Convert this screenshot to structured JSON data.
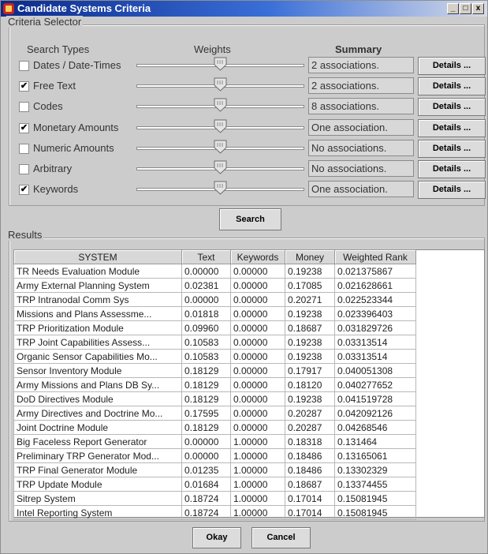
{
  "window": {
    "title": "Candidate Systems Criteria"
  },
  "criteria_selector": {
    "group_title": "Criteria Selector",
    "headers": {
      "search_types": "Search Types",
      "weights": "Weights",
      "summary": "Summary"
    },
    "rows": [
      {
        "label": "Dates / Date-Times",
        "checked": false,
        "weight_percent": 50,
        "summary": "2 associations.",
        "details_label": "Details ..."
      },
      {
        "label": "Free Text",
        "checked": true,
        "weight_percent": 50,
        "summary": "2 associations.",
        "details_label": "Details ..."
      },
      {
        "label": "Codes",
        "checked": false,
        "weight_percent": 50,
        "summary": "8 associations.",
        "details_label": "Details ..."
      },
      {
        "label": "Monetary Amounts",
        "checked": true,
        "weight_percent": 50,
        "summary": "One association.",
        "details_label": "Details ..."
      },
      {
        "label": "Numeric Amounts",
        "checked": false,
        "weight_percent": 50,
        "summary": "No associations.",
        "details_label": "Details ..."
      },
      {
        "label": "Arbitrary",
        "checked": false,
        "weight_percent": 50,
        "summary": "No associations.",
        "details_label": "Details ..."
      },
      {
        "label": "Keywords",
        "checked": true,
        "weight_percent": 50,
        "summary": "One association.",
        "details_label": "Details ..."
      }
    ]
  },
  "search_button": "Search",
  "results": {
    "group_title": "Results",
    "columns": [
      "SYSTEM",
      "Text",
      "Keywords",
      "Money",
      "Weighted Rank"
    ],
    "rows": [
      [
        "TR Needs Evaluation Module",
        "0.00000",
        "0.00000",
        "0.19238",
        "0.021375867"
      ],
      [
        "Army External Planning System",
        "0.02381",
        "0.00000",
        "0.17085",
        "0.021628661"
      ],
      [
        "TRP Intranodal Comm Sys",
        "0.00000",
        "0.00000",
        "0.20271",
        "0.022523344"
      ],
      [
        "Missions and Plans Assessme...",
        "0.01818",
        "0.00000",
        "0.19238",
        "0.023396403"
      ],
      [
        "TRP Prioritization Module",
        "0.09960",
        "0.00000",
        "0.18687",
        "0.031829726"
      ],
      [
        "TRP Joint Capabilities Assess...",
        "0.10583",
        "0.00000",
        "0.19238",
        "0.03313514"
      ],
      [
        "Organic Sensor Capabilities Mo...",
        "0.10583",
        "0.00000",
        "0.19238",
        "0.03313514"
      ],
      [
        "Sensor Inventory Module",
        "0.18129",
        "0.00000",
        "0.17917",
        "0.040051308"
      ],
      [
        "Army Missions and Plans DB Sy...",
        "0.18129",
        "0.00000",
        "0.18120",
        "0.040277652"
      ],
      [
        "DoD Directives Module",
        "0.18129",
        "0.00000",
        "0.19238",
        "0.041519728"
      ],
      [
        "Army Directives and Doctrine Mo...",
        "0.17595",
        "0.00000",
        "0.20287",
        "0.042092126"
      ],
      [
        "Joint Doctrine Module",
        "0.18129",
        "0.00000",
        "0.20287",
        "0.04268546"
      ],
      [
        "Big Faceless Report Generator",
        "0.00000",
        "1.00000",
        "0.18318",
        "0.131464"
      ],
      [
        "Preliminary TRP Generator Mod...",
        "0.00000",
        "1.00000",
        "0.18486",
        "0.13165061"
      ],
      [
        "TRP Final Generator Module",
        "0.01235",
        "1.00000",
        "0.18486",
        "0.13302329"
      ],
      [
        "TRP Update Module",
        "0.01684",
        "1.00000",
        "0.18687",
        "0.13374455"
      ],
      [
        "Sitrep System",
        "0.18724",
        "1.00000",
        "0.17014",
        "0.15081945"
      ],
      [
        "Intel Reporting System",
        "0.18724",
        "1.00000",
        "0.17014",
        "0.15081945"
      ]
    ]
  },
  "buttons": {
    "okay": "Okay",
    "cancel": "Cancel"
  },
  "icons": {
    "app": "app-icon",
    "slider_thumb": "slider-thumb-icon",
    "check": "checkmark-icon"
  }
}
